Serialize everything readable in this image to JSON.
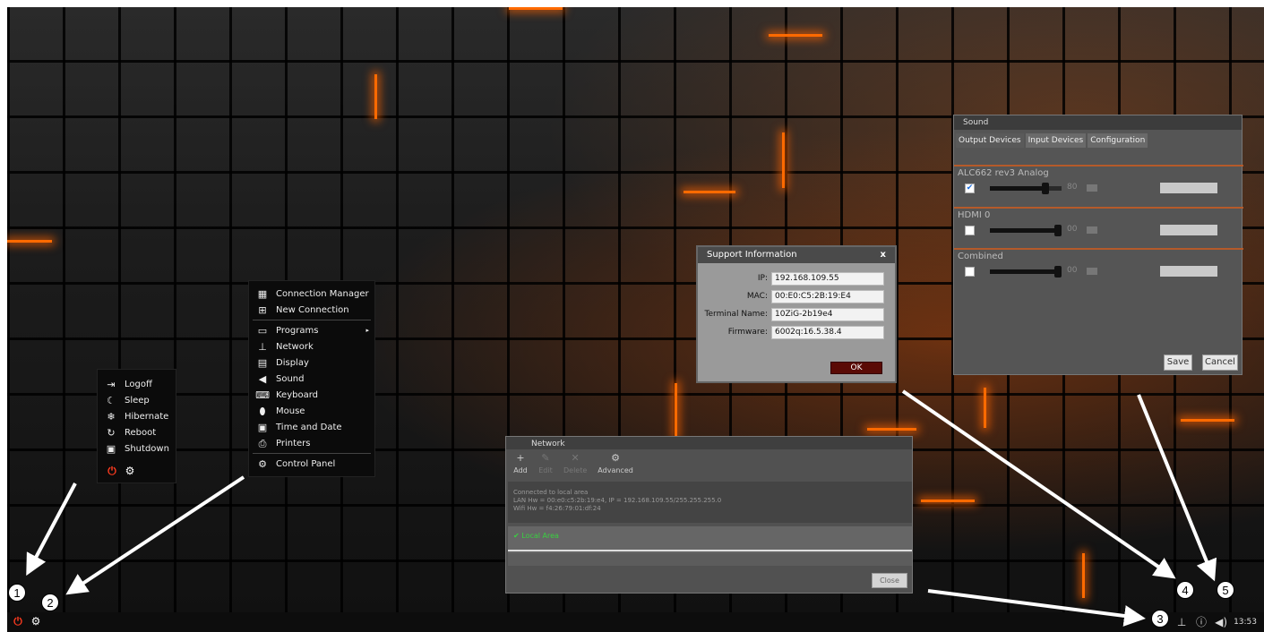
{
  "start_menu": {
    "items": [
      {
        "label": "Logoff",
        "icon": "logoff-icon",
        "glyph": "⇥"
      },
      {
        "label": "Sleep",
        "icon": "moon-icon",
        "glyph": "☾"
      },
      {
        "label": "Hibernate",
        "icon": "snowflake-icon",
        "glyph": "❄"
      },
      {
        "label": "Reboot",
        "icon": "reboot-icon",
        "glyph": "↻"
      },
      {
        "label": "Shutdown",
        "icon": "shutdown-icon",
        "glyph": "▣"
      }
    ]
  },
  "config_menu": {
    "items": [
      {
        "label": "Connection Manager",
        "icon": "grid-icon",
        "glyph": "▦"
      },
      {
        "label": "New Connection",
        "icon": "plus-box-icon",
        "glyph": "⊞"
      },
      {
        "label": "Programs",
        "icon": "folder-icon",
        "glyph": "▭",
        "submenu": "▸"
      },
      {
        "label": "Network",
        "icon": "network-icon",
        "glyph": "⊥"
      },
      {
        "label": "Display",
        "icon": "display-icon",
        "glyph": "▤"
      },
      {
        "label": "Sound",
        "icon": "speaker-icon",
        "glyph": "◀"
      },
      {
        "label": "Keyboard",
        "icon": "keyboard-icon",
        "glyph": "⌨"
      },
      {
        "label": "Mouse",
        "icon": "mouse-icon",
        "glyph": "⬮"
      },
      {
        "label": "Time and Date",
        "icon": "calendar-icon",
        "glyph": "▣"
      },
      {
        "label": "Printers",
        "icon": "printer-icon",
        "glyph": "⎙"
      },
      {
        "label": "Control Panel",
        "icon": "gear-icon",
        "glyph": "⚙"
      }
    ]
  },
  "support": {
    "title": "Support Information",
    "close": "x",
    "fields": [
      {
        "label": "IP:",
        "value": "192.168.109.55"
      },
      {
        "label": "MAC:",
        "value": "00:E0:C5:2B:19:E4"
      },
      {
        "label": "Terminal Name:",
        "value": "10ZiG-2b19e4"
      },
      {
        "label": "Firmware:",
        "value": "6002q:16.5.38.4"
      }
    ],
    "ok": "OK"
  },
  "sound": {
    "title": "Sound",
    "tabs": [
      "Output Devices",
      "Input Devices",
      "Configuration"
    ],
    "devices": [
      {
        "name": "ALC662 rev3 Analog",
        "checked": true,
        "level": 80,
        "level_label": "80"
      },
      {
        "name": "HDMI 0",
        "checked": false,
        "level": 100,
        "level_label": "00"
      },
      {
        "name": "Combined",
        "checked": false,
        "level": 100,
        "level_label": "00"
      }
    ],
    "save": "Save",
    "cancel": "Cancel"
  },
  "network": {
    "title": "Network",
    "tools": [
      {
        "label": "Add",
        "icon": "plus-icon",
        "glyph": "+",
        "enabled": true
      },
      {
        "label": "Edit",
        "icon": "pencil-icon",
        "glyph": "✎",
        "enabled": false
      },
      {
        "label": "Delete",
        "icon": "x-icon",
        "glyph": "✕",
        "enabled": false
      },
      {
        "label": "Advanced",
        "icon": "gears-icon",
        "glyph": "⚙",
        "enabled": true
      }
    ],
    "info_lines": [
      "Connected to local area",
      "LAN Hw = 00:e0:c5:2b:19:e4, IP = 192.168.109.55/255.255.255.0",
      "Wifi Hw = f4:26:79:01:df:24"
    ],
    "connection": "Local Area",
    "close": "Close"
  },
  "taskbar": {
    "clock": "13:53"
  },
  "callouts": [
    "1",
    "2",
    "3",
    "4",
    "5"
  ]
}
